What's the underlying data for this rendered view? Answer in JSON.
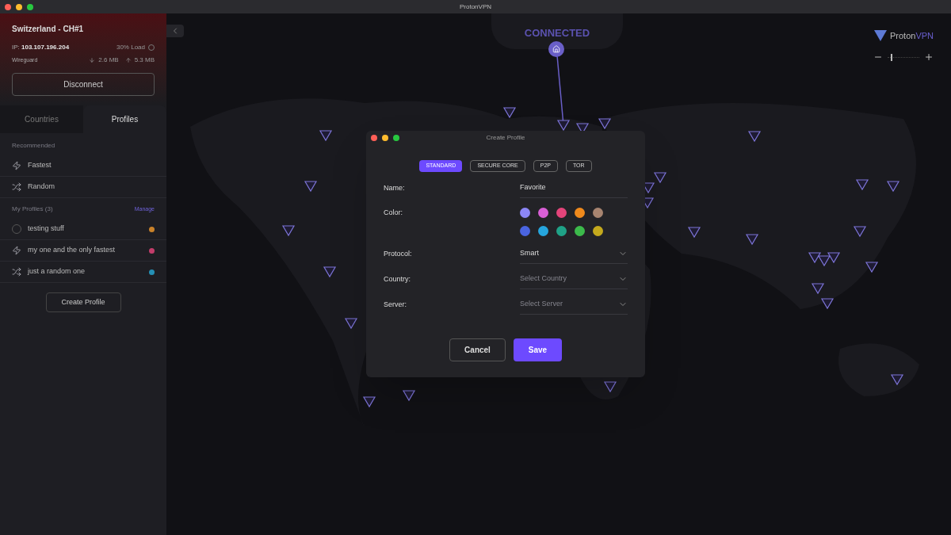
{
  "window": {
    "title": "ProtonVPN"
  },
  "connection": {
    "server": "Switzerland - CH#1",
    "ip_label": "IP:",
    "ip": "103.107.196.204",
    "load": "30% Load",
    "protocol": "Wireguard",
    "download": "2.6 MB",
    "upload": "5.3 MB",
    "disconnect": "Disconnect"
  },
  "tabs": [
    {
      "label": "Countries",
      "selected": false
    },
    {
      "label": "Profiles",
      "selected": true
    }
  ],
  "recommended": {
    "heading": "Recommended",
    "items": [
      {
        "kind": "bolt",
        "label": "Fastest"
      },
      {
        "kind": "shuffle",
        "label": "Random"
      }
    ]
  },
  "my_profiles": {
    "heading": "My Profiles (3)",
    "manage": "Manage",
    "items": [
      {
        "kind": "ring",
        "label": "testing stuff",
        "color": "#c9822a"
      },
      {
        "kind": "bolt",
        "label": "my one and the only fastest",
        "color": "#c23d6a"
      },
      {
        "kind": "shuffle",
        "label": "just a random one",
        "color": "#2590b5"
      }
    ]
  },
  "create_profile": "Create Profile",
  "map": {
    "status": "CONNECTED",
    "brand": {
      "first": "Proton",
      "second": "VPN"
    },
    "zoom": {
      "level": 0.1
    }
  },
  "dialog": {
    "title": "Create Profile",
    "types": [
      {
        "label": "STANDARD",
        "selected": true
      },
      {
        "label": "SECURE CORE",
        "selected": false
      },
      {
        "label": "P2P",
        "selected": false
      },
      {
        "label": "TOR",
        "selected": false
      }
    ],
    "name_label": "Name:",
    "name_value": "Favorite",
    "color_label": "Color:",
    "colors": [
      {
        "color": "#8b86f5"
      },
      {
        "color": "#d95fd6"
      },
      {
        "color": "#e4447a"
      },
      {
        "color": "#f08a1c"
      },
      {
        "color": "#a78470"
      },
      {
        "color": "#4a64e0"
      },
      {
        "color": "#26a6de"
      },
      {
        "color": "#1fa287"
      },
      {
        "color": "#3cba4b"
      },
      {
        "color": "#c4a91d"
      }
    ],
    "selects": [
      {
        "label": "Protocol:",
        "value": "Smart"
      },
      {
        "label": "Country:",
        "placeholder": "Select Country"
      },
      {
        "label": "Server:",
        "placeholder": "Select Server"
      }
    ],
    "cancel": "Cancel",
    "save": "Save"
  }
}
